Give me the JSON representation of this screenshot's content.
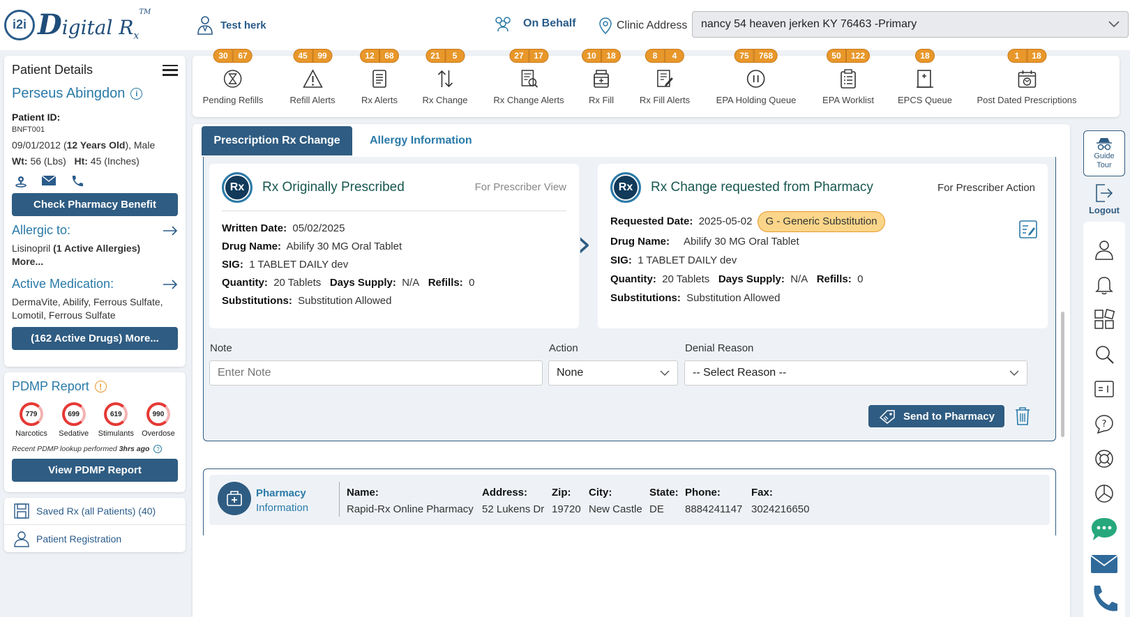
{
  "header": {
    "logo_badge": "i2i",
    "logo_letter": "D",
    "logo_word": "igital R",
    "logo_sub": "x",
    "logo_tm": "TM",
    "user_name": "Test herk",
    "on_behalf": "On Behalf",
    "clinic_label": "Clinic Address",
    "clinic_value": "nancy 54 heaven jerken KY 76463 -Primary"
  },
  "patient": {
    "section_title": "Patient Details",
    "name": "Perseus Abingdon",
    "id_label": "Patient ID:",
    "id_value": "BNFT001",
    "dob": "09/01/2012 (",
    "age": "12 Years Old",
    "gender": "), Male",
    "wt_label": "Wt:",
    "wt_value": "56 (Lbs)",
    "ht_label": "Ht:",
    "ht_value": "45 (Inches)",
    "check_benefit": "Check Pharmacy Benefit",
    "allergic_title": "Allergic to:",
    "allergy_name": "Lisinopril",
    "allergy_count": "(1 Active Allergies)",
    "allergy_more": "More...",
    "med_title": "Active Medication:",
    "med_list": "DermaVite, Abilify, Ferrous Sulfate, Lomotil, Ferrous Sulfate",
    "med_more_button": "(162 Active Drugs) More..."
  },
  "pdmp": {
    "title": "PDMP Report",
    "gauges": [
      {
        "value": "779",
        "label": "Narcotics"
      },
      {
        "value": "699",
        "label": "Sedative"
      },
      {
        "value": "619",
        "label": "Stimulants"
      },
      {
        "value": "990",
        "label": "Overdose"
      }
    ],
    "recent_prefix": "Recent PDMP lookup performed ",
    "recent_time": "3hrs ago",
    "view_button": "View PDMP Report"
  },
  "side_links": {
    "saved_rx": "Saved Rx (all Patients) (40)",
    "registration": "Patient Registration"
  },
  "queues": [
    {
      "label": "Pending Refills",
      "badges": [
        "30",
        "67"
      ],
      "icon": "hourglass-icon"
    },
    {
      "label": "Refill Alerts",
      "badges": [
        "45",
        "99"
      ],
      "icon": "warning-icon"
    },
    {
      "label": "Rx Alerts",
      "badges": [
        "12",
        "68"
      ],
      "icon": "document-icon"
    },
    {
      "label": "Rx Change",
      "badges": [
        "21",
        "5"
      ],
      "icon": "arrows-updown-icon"
    },
    {
      "label": "Rx Change Alerts",
      "badges": [
        "27",
        "17"
      ],
      "icon": "doc-search-icon"
    },
    {
      "label": "Rx Fill",
      "badges": [
        "10",
        "18"
      ],
      "icon": "pill-bottle-icon"
    },
    {
      "label": "Rx Fill Alerts",
      "badges": [
        "8",
        "4"
      ],
      "icon": "doc-edit-icon"
    },
    {
      "label": "EPA Holding Queue",
      "badges": [
        "75",
        "768"
      ],
      "icon": "pause-icon"
    },
    {
      "label": "EPA Worklist",
      "badges": [
        "50",
        "122"
      ],
      "icon": "clipboard-icon"
    },
    {
      "label": "EPCS Queue",
      "badges": [
        "18"
      ],
      "icon": "doc-plus-icon"
    },
    {
      "label": "Post Dated Prescriptions",
      "badges": [
        "1",
        "18"
      ],
      "icon": "calendar-icon"
    }
  ],
  "tabs": {
    "active": "Prescription Rx Change",
    "other": "Allergy Information"
  },
  "rx_original": {
    "logo": "Rx",
    "title": "Rx Originally Prescribed",
    "subtitle": "For Prescriber View",
    "written_label": "Written Date:",
    "written_value": "05/02/2025",
    "drug_label": "Drug Name:",
    "drug_value": "Abilify 30 MG Oral Tablet",
    "sig_label": "SIG:",
    "sig_value": "1 TABLET DAILY dev",
    "qty_label": "Quantity:",
    "qty_value": "20 Tablets",
    "days_label": "Days Supply:",
    "days_value": "N/A",
    "refills_label": "Refills:",
    "refills_value": "0",
    "subs_label": "Substitutions:",
    "subs_value": "Substitution Allowed"
  },
  "rx_change": {
    "logo": "Rx",
    "title": "Rx Change requested from Pharmacy",
    "subtitle": "For Prescriber Action",
    "requested_label": "Requested Date:",
    "requested_value": "2025-05-02",
    "change_badge": "G - Generic Substitution",
    "drug_label": "Drug Name:",
    "drug_value": "Abilify 30 MG Oral Tablet",
    "sig_label": "SIG:",
    "sig_value": "1 TABLET DAILY dev",
    "qty_label": "Quantity:",
    "qty_value": "20 Tablets",
    "days_label": "Days Supply:",
    "days_value": "N/A",
    "refills_label": "Refills:",
    "refills_value": "0",
    "subs_label": "Substitutions:",
    "subs_value": "Substitution Allowed"
  },
  "form": {
    "note_label": "Note",
    "note_placeholder": "Enter Note",
    "action_label": "Action",
    "action_value": "None",
    "denial_label": "Denial Reason",
    "denial_value": "-- Select Reason --",
    "send_button": "Send to Pharmacy"
  },
  "pharmacy": {
    "title_line1": "Pharmacy",
    "title_line2": "Information",
    "name_label": "Name:",
    "name_value": "Rapid-Rx Online Pharmacy",
    "address_label": "Address:",
    "address_value": "52 Lukens Dr",
    "zip_label": "Zip:",
    "zip_value": "19720",
    "city_label": "City:",
    "city_value": "New Castle",
    "state_label": "State:",
    "state_value": "DE",
    "phone_label": "Phone:",
    "phone_value": "8884241147",
    "fax_label": "Fax:",
    "fax_value": "3024216650"
  },
  "rail": {
    "guide_tour": "Guide Tour",
    "logout": "Logout"
  },
  "colors": {
    "primary": "#2f5c82",
    "accent": "#2a7aa8",
    "badge": "#e8972a",
    "alert": "#e53935"
  }
}
